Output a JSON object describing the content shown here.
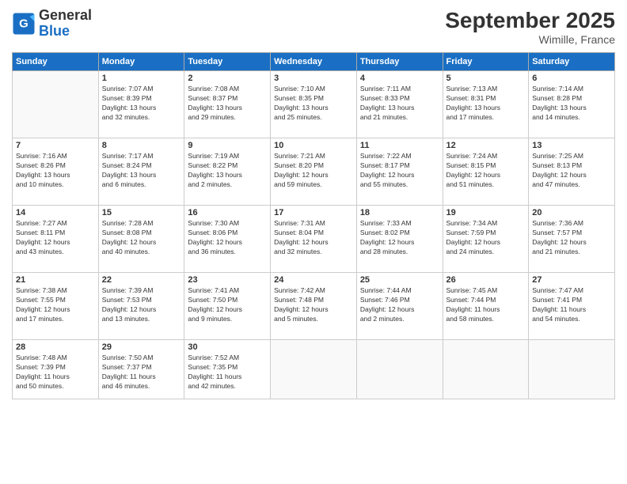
{
  "header": {
    "logo_line1": "General",
    "logo_line2": "Blue",
    "month_title": "September 2025",
    "location": "Wimille, France"
  },
  "days_of_week": [
    "Sunday",
    "Monday",
    "Tuesday",
    "Wednesday",
    "Thursday",
    "Friday",
    "Saturday"
  ],
  "weeks": [
    [
      {
        "day": "",
        "info": ""
      },
      {
        "day": "1",
        "info": "Sunrise: 7:07 AM\nSunset: 8:39 PM\nDaylight: 13 hours\nand 32 minutes."
      },
      {
        "day": "2",
        "info": "Sunrise: 7:08 AM\nSunset: 8:37 PM\nDaylight: 13 hours\nand 29 minutes."
      },
      {
        "day": "3",
        "info": "Sunrise: 7:10 AM\nSunset: 8:35 PM\nDaylight: 13 hours\nand 25 minutes."
      },
      {
        "day": "4",
        "info": "Sunrise: 7:11 AM\nSunset: 8:33 PM\nDaylight: 13 hours\nand 21 minutes."
      },
      {
        "day": "5",
        "info": "Sunrise: 7:13 AM\nSunset: 8:31 PM\nDaylight: 13 hours\nand 17 minutes."
      },
      {
        "day": "6",
        "info": "Sunrise: 7:14 AM\nSunset: 8:28 PM\nDaylight: 13 hours\nand 14 minutes."
      }
    ],
    [
      {
        "day": "7",
        "info": "Sunrise: 7:16 AM\nSunset: 8:26 PM\nDaylight: 13 hours\nand 10 minutes."
      },
      {
        "day": "8",
        "info": "Sunrise: 7:17 AM\nSunset: 8:24 PM\nDaylight: 13 hours\nand 6 minutes."
      },
      {
        "day": "9",
        "info": "Sunrise: 7:19 AM\nSunset: 8:22 PM\nDaylight: 13 hours\nand 2 minutes."
      },
      {
        "day": "10",
        "info": "Sunrise: 7:21 AM\nSunset: 8:20 PM\nDaylight: 12 hours\nand 59 minutes."
      },
      {
        "day": "11",
        "info": "Sunrise: 7:22 AM\nSunset: 8:17 PM\nDaylight: 12 hours\nand 55 minutes."
      },
      {
        "day": "12",
        "info": "Sunrise: 7:24 AM\nSunset: 8:15 PM\nDaylight: 12 hours\nand 51 minutes."
      },
      {
        "day": "13",
        "info": "Sunrise: 7:25 AM\nSunset: 8:13 PM\nDaylight: 12 hours\nand 47 minutes."
      }
    ],
    [
      {
        "day": "14",
        "info": "Sunrise: 7:27 AM\nSunset: 8:11 PM\nDaylight: 12 hours\nand 43 minutes."
      },
      {
        "day": "15",
        "info": "Sunrise: 7:28 AM\nSunset: 8:08 PM\nDaylight: 12 hours\nand 40 minutes."
      },
      {
        "day": "16",
        "info": "Sunrise: 7:30 AM\nSunset: 8:06 PM\nDaylight: 12 hours\nand 36 minutes."
      },
      {
        "day": "17",
        "info": "Sunrise: 7:31 AM\nSunset: 8:04 PM\nDaylight: 12 hours\nand 32 minutes."
      },
      {
        "day": "18",
        "info": "Sunrise: 7:33 AM\nSunset: 8:02 PM\nDaylight: 12 hours\nand 28 minutes."
      },
      {
        "day": "19",
        "info": "Sunrise: 7:34 AM\nSunset: 7:59 PM\nDaylight: 12 hours\nand 24 minutes."
      },
      {
        "day": "20",
        "info": "Sunrise: 7:36 AM\nSunset: 7:57 PM\nDaylight: 12 hours\nand 21 minutes."
      }
    ],
    [
      {
        "day": "21",
        "info": "Sunrise: 7:38 AM\nSunset: 7:55 PM\nDaylight: 12 hours\nand 17 minutes."
      },
      {
        "day": "22",
        "info": "Sunrise: 7:39 AM\nSunset: 7:53 PM\nDaylight: 12 hours\nand 13 minutes."
      },
      {
        "day": "23",
        "info": "Sunrise: 7:41 AM\nSunset: 7:50 PM\nDaylight: 12 hours\nand 9 minutes."
      },
      {
        "day": "24",
        "info": "Sunrise: 7:42 AM\nSunset: 7:48 PM\nDaylight: 12 hours\nand 5 minutes."
      },
      {
        "day": "25",
        "info": "Sunrise: 7:44 AM\nSunset: 7:46 PM\nDaylight: 12 hours\nand 2 minutes."
      },
      {
        "day": "26",
        "info": "Sunrise: 7:45 AM\nSunset: 7:44 PM\nDaylight: 11 hours\nand 58 minutes."
      },
      {
        "day": "27",
        "info": "Sunrise: 7:47 AM\nSunset: 7:41 PM\nDaylight: 11 hours\nand 54 minutes."
      }
    ],
    [
      {
        "day": "28",
        "info": "Sunrise: 7:48 AM\nSunset: 7:39 PM\nDaylight: 11 hours\nand 50 minutes."
      },
      {
        "day": "29",
        "info": "Sunrise: 7:50 AM\nSunset: 7:37 PM\nDaylight: 11 hours\nand 46 minutes."
      },
      {
        "day": "30",
        "info": "Sunrise: 7:52 AM\nSunset: 7:35 PM\nDaylight: 11 hours\nand 42 minutes."
      },
      {
        "day": "",
        "info": ""
      },
      {
        "day": "",
        "info": ""
      },
      {
        "day": "",
        "info": ""
      },
      {
        "day": "",
        "info": ""
      }
    ]
  ]
}
